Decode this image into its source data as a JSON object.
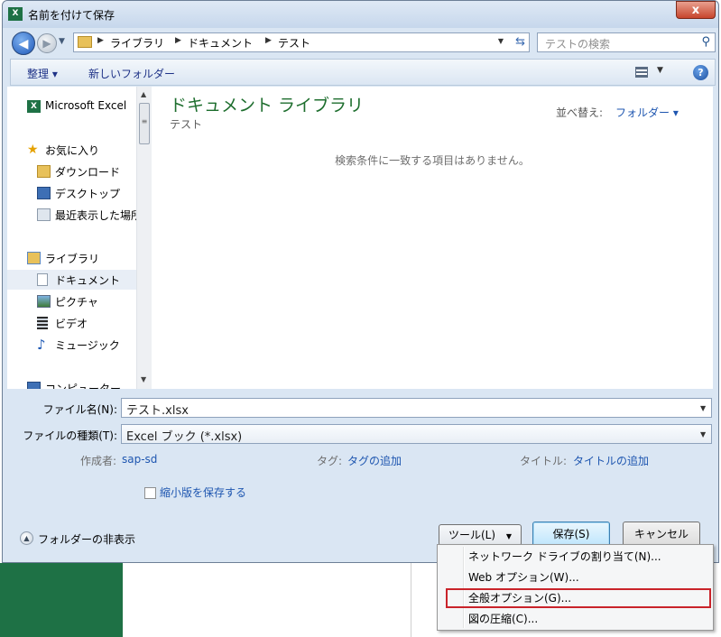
{
  "window": {
    "title": "名前を付けて保存",
    "app_icon_text": "X",
    "close_label": "x"
  },
  "address": {
    "crumbs": [
      "ライブラリ",
      "ドキュメント",
      "テスト"
    ],
    "search_placeholder": "テストの検索"
  },
  "toolbar": {
    "organize_label": "整理 ▾",
    "new_folder_label": "新しいフォルダー"
  },
  "nav": {
    "items": [
      {
        "label": "Microsoft Excel",
        "icon": "excel-icon"
      },
      {
        "label": "お気に入り",
        "icon": "star-icon"
      },
      {
        "label": "ダウンロード",
        "icon": "download-folder-icon"
      },
      {
        "label": "デスクトップ",
        "icon": "desktop-icon"
      },
      {
        "label": "最近表示した場所",
        "icon": "recent-places-icon"
      },
      {
        "label": "ライブラリ",
        "icon": "library-icon"
      },
      {
        "label": "ドキュメント",
        "icon": "documents-icon",
        "selected": true
      },
      {
        "label": "ピクチャ",
        "icon": "pictures-icon"
      },
      {
        "label": "ビデオ",
        "icon": "videos-icon"
      },
      {
        "label": "ミュージック",
        "icon": "music-icon"
      },
      {
        "label": "コンピューター",
        "icon": "computer-icon"
      }
    ]
  },
  "main": {
    "library_title": "ドキュメント ライブラリ",
    "library_subtitle": "テスト",
    "sort_label": "並べ替え:",
    "sort_value": "フォルダー ▾",
    "empty_message": "検索条件に一致する項目はありません。"
  },
  "form": {
    "filename_label": "ファイル名(N):",
    "filename_value": "テスト.xlsx",
    "filetype_label": "ファイルの種類(T):",
    "filetype_value": "Excel ブック (*.xlsx)",
    "author_label": "作成者:",
    "author_value": "sap-sd",
    "tags_label": "タグ:",
    "tags_value": "タグの追加",
    "title_label": "タイトル:",
    "title_value": "タイトルの追加",
    "thumbnail_label": "縮小版を保存する",
    "hide_folders_label": "フォルダーの非表示"
  },
  "buttons": {
    "tools_label": "ツール(L)",
    "save_label": "保存(S)",
    "cancel_label": "キャンセル"
  },
  "tools_menu": {
    "items": [
      "ネットワーク ドライブの割り当て(N)...",
      "Web オプション(W)...",
      "全般オプション(G)...",
      "図の圧縮(C)..."
    ],
    "highlighted_index": 2,
    "highlight_color": "#c9232a"
  },
  "colors": {
    "library_title": "#1e6e2e",
    "link": "#1e56b0",
    "excel_green": "#1e7145"
  }
}
